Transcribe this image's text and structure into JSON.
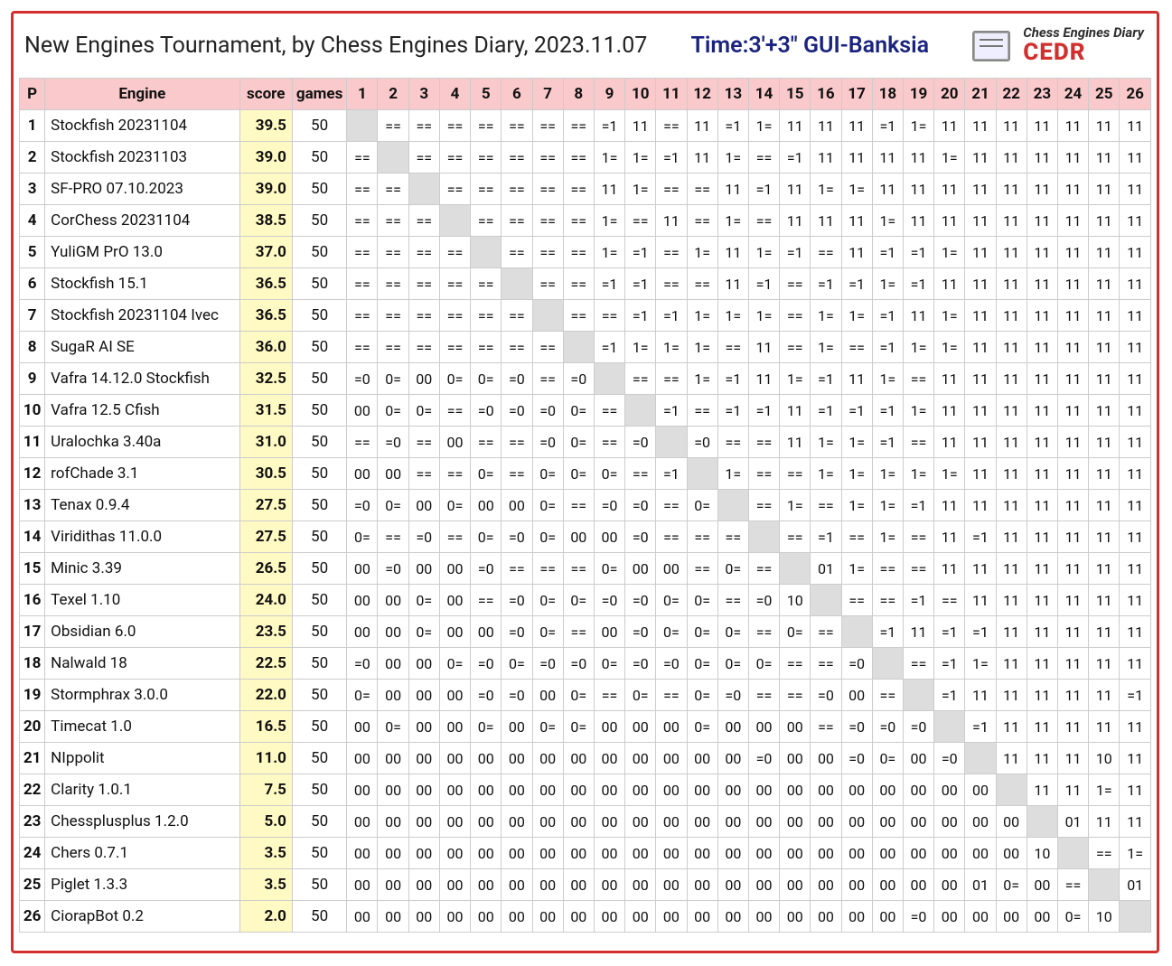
{
  "header": {
    "title": "New Engines Tournament, by Chess Engines Diary, 2023.11.07",
    "meta": "Time:3'+3\"  GUI-Banksia",
    "brand_line1": "Chess Engines Diary",
    "brand_line2": "CEDR"
  },
  "columns": {
    "p": "P",
    "engine": "Engine",
    "score": "score",
    "games": "games",
    "rounds": [
      "1",
      "2",
      "3",
      "4",
      "5",
      "6",
      "7",
      "8",
      "9",
      "10",
      "11",
      "12",
      "13",
      "14",
      "15",
      "16",
      "17",
      "18",
      "19",
      "20",
      "21",
      "22",
      "23",
      "24",
      "25",
      "26"
    ]
  },
  "rows": [
    {
      "p": "1",
      "engine": "Stockfish 20231104",
      "score": "39.5",
      "games": "50",
      "r": [
        "",
        "==",
        "==",
        "==",
        "==",
        "==",
        "==",
        "==",
        "=1",
        "11",
        "==",
        "11",
        "=1",
        "1=",
        "11",
        "11",
        "11",
        "=1",
        "1=",
        "11",
        "11",
        "11",
        "11",
        "11",
        "11",
        "11"
      ]
    },
    {
      "p": "2",
      "engine": "Stockfish 20231103",
      "score": "39.0",
      "games": "50",
      "r": [
        "==",
        "",
        "==",
        "==",
        "==",
        "==",
        "==",
        "==",
        "1=",
        "1=",
        "=1",
        "11",
        "1=",
        "==",
        "=1",
        "11",
        "11",
        "11",
        "11",
        "1=",
        "11",
        "11",
        "11",
        "11",
        "11",
        "11"
      ]
    },
    {
      "p": "3",
      "engine": "SF-PRO 07.10.2023",
      "score": "39.0",
      "games": "50",
      "r": [
        "==",
        "==",
        "",
        "==",
        "==",
        "==",
        "==",
        "==",
        "11",
        "1=",
        "==",
        "==",
        "11",
        "=1",
        "11",
        "1=",
        "1=",
        "11",
        "11",
        "11",
        "11",
        "11",
        "11",
        "11",
        "11",
        "11"
      ]
    },
    {
      "p": "4",
      "engine": "CorChess 20231104",
      "score": "38.5",
      "games": "50",
      "r": [
        "==",
        "==",
        "==",
        "",
        "==",
        "==",
        "==",
        "==",
        "1=",
        "==",
        "11",
        "==",
        "1=",
        "==",
        "11",
        "11",
        "11",
        "1=",
        "11",
        "11",
        "11",
        "11",
        "11",
        "11",
        "11",
        "11"
      ]
    },
    {
      "p": "5",
      "engine": "YuliGM PrO 13.0",
      "score": "37.0",
      "games": "50",
      "r": [
        "==",
        "==",
        "==",
        "==",
        "",
        "==",
        "==",
        "==",
        "1=",
        "=1",
        "==",
        "1=",
        "11",
        "1=",
        "=1",
        "==",
        "11",
        "=1",
        "=1",
        "1=",
        "11",
        "11",
        "11",
        "11",
        "11",
        "11"
      ]
    },
    {
      "p": "6",
      "engine": "Stockfish 15.1",
      "score": "36.5",
      "games": "50",
      "r": [
        "==",
        "==",
        "==",
        "==",
        "==",
        "",
        "==",
        "==",
        "=1",
        "=1",
        "==",
        "==",
        "11",
        "=1",
        "==",
        "=1",
        "=1",
        "1=",
        "=1",
        "11",
        "11",
        "11",
        "11",
        "11",
        "11",
        "11"
      ]
    },
    {
      "p": "7",
      "engine": "Stockfish 20231104 Ivec",
      "score": "36.5",
      "games": "50",
      "r": [
        "==",
        "==",
        "==",
        "==",
        "==",
        "==",
        "",
        "==",
        "==",
        "=1",
        "=1",
        "1=",
        "1=",
        "1=",
        "==",
        "1=",
        "1=",
        "=1",
        "11",
        "1=",
        "11",
        "11",
        "11",
        "11",
        "11",
        "11"
      ]
    },
    {
      "p": "8",
      "engine": "SugaR AI SE",
      "score": "36.0",
      "games": "50",
      "r": [
        "==",
        "==",
        "==",
        "==",
        "==",
        "==",
        "==",
        "",
        "=1",
        "1=",
        "1=",
        "1=",
        "==",
        "11",
        "==",
        "1=",
        "==",
        "=1",
        "1=",
        "1=",
        "11",
        "11",
        "11",
        "11",
        "11",
        "11"
      ]
    },
    {
      "p": "9",
      "engine": "Vafra 14.12.0 Stockfish",
      "score": "32.5",
      "games": "50",
      "r": [
        "=0",
        "0=",
        "00",
        "0=",
        "0=",
        "=0",
        "==",
        "=0",
        "",
        "==",
        "==",
        "1=",
        "=1",
        "11",
        "1=",
        "=1",
        "11",
        "1=",
        "==",
        "11",
        "11",
        "11",
        "11",
        "11",
        "11",
        "11"
      ]
    },
    {
      "p": "10",
      "engine": "Vafra 12.5 Cfish",
      "score": "31.5",
      "games": "50",
      "r": [
        "00",
        "0=",
        "0=",
        "==",
        "=0",
        "=0",
        "=0",
        "0=",
        "==",
        "",
        "=1",
        "==",
        "=1",
        "=1",
        "11",
        "=1",
        "=1",
        "=1",
        "1=",
        "11",
        "11",
        "11",
        "11",
        "11",
        "11",
        "11"
      ]
    },
    {
      "p": "11",
      "engine": "Uralochka 3.40a",
      "score": "31.0",
      "games": "50",
      "r": [
        "==",
        "=0",
        "==",
        "00",
        "==",
        "==",
        "=0",
        "0=",
        "==",
        "=0",
        "",
        "=0",
        "==",
        "==",
        "11",
        "1=",
        "1=",
        "=1",
        "==",
        "11",
        "11",
        "11",
        "11",
        "11",
        "11",
        "11"
      ]
    },
    {
      "p": "12",
      "engine": "rofChade 3.1",
      "score": "30.5",
      "games": "50",
      "r": [
        "00",
        "00",
        "==",
        "==",
        "0=",
        "==",
        "0=",
        "0=",
        "0=",
        "==",
        "=1",
        "",
        "1=",
        "==",
        "==",
        "1=",
        "1=",
        "1=",
        "1=",
        "1=",
        "11",
        "11",
        "11",
        "11",
        "11",
        "11"
      ]
    },
    {
      "p": "13",
      "engine": "Tenax 0.9.4",
      "score": "27.5",
      "games": "50",
      "r": [
        "=0",
        "0=",
        "00",
        "0=",
        "00",
        "00",
        "0=",
        "==",
        "=0",
        "=0",
        "==",
        "0=",
        "",
        "==",
        "1=",
        "==",
        "1=",
        "1=",
        "=1",
        "11",
        "11",
        "11",
        "11",
        "11",
        "11",
        "11"
      ]
    },
    {
      "p": "14",
      "engine": "Viridithas 11.0.0",
      "score": "27.5",
      "games": "50",
      "r": [
        "0=",
        "==",
        "=0",
        "==",
        "0=",
        "=0",
        "0=",
        "00",
        "00",
        "=0",
        "==",
        "==",
        "==",
        "",
        "==",
        "=1",
        "==",
        "1=",
        "==",
        "11",
        "=1",
        "11",
        "11",
        "11",
        "11",
        "11"
      ]
    },
    {
      "p": "15",
      "engine": "Minic 3.39",
      "score": "26.5",
      "games": "50",
      "r": [
        "00",
        "=0",
        "00",
        "00",
        "=0",
        "==",
        "==",
        "==",
        "0=",
        "00",
        "00",
        "==",
        "0=",
        "==",
        "",
        "01",
        "1=",
        "==",
        "==",
        "11",
        "11",
        "11",
        "11",
        "11",
        "11",
        "11"
      ]
    },
    {
      "p": "16",
      "engine": "Texel 1.10",
      "score": "24.0",
      "games": "50",
      "r": [
        "00",
        "00",
        "0=",
        "00",
        "==",
        "=0",
        "0=",
        "0=",
        "=0",
        "=0",
        "0=",
        "0=",
        "==",
        "=0",
        "10",
        "",
        "==",
        "==",
        "=1",
        "==",
        "11",
        "11",
        "11",
        "11",
        "11",
        "11"
      ]
    },
    {
      "p": "17",
      "engine": "Obsidian 6.0",
      "score": "23.5",
      "games": "50",
      "r": [
        "00",
        "00",
        "0=",
        "00",
        "00",
        "=0",
        "0=",
        "==",
        "00",
        "=0",
        "0=",
        "0=",
        "0=",
        "==",
        "0=",
        "==",
        "",
        "=1",
        "11",
        "=1",
        "=1",
        "11",
        "11",
        "11",
        "11",
        "11"
      ]
    },
    {
      "p": "18",
      "engine": "Nalwald 18",
      "score": "22.5",
      "games": "50",
      "r": [
        "=0",
        "00",
        "00",
        "0=",
        "=0",
        "0=",
        "=0",
        "=0",
        "0=",
        "=0",
        "=0",
        "0=",
        "0=",
        "0=",
        "==",
        "==",
        "=0",
        "",
        "==",
        "=1",
        "1=",
        "11",
        "11",
        "11",
        "11",
        "11"
      ]
    },
    {
      "p": "19",
      "engine": "Stormphrax 3.0.0",
      "score": "22.0",
      "games": "50",
      "r": [
        "0=",
        "00",
        "00",
        "00",
        "=0",
        "=0",
        "00",
        "0=",
        "==",
        "0=",
        "==",
        "0=",
        "=0",
        "==",
        "==",
        "=0",
        "00",
        "==",
        "",
        "=1",
        "11",
        "11",
        "11",
        "11",
        "11",
        "=1"
      ]
    },
    {
      "p": "20",
      "engine": "Timecat 1.0",
      "score": "16.5",
      "games": "50",
      "r": [
        "00",
        "0=",
        "00",
        "00",
        "0=",
        "00",
        "0=",
        "0=",
        "00",
        "00",
        "00",
        "0=",
        "00",
        "00",
        "00",
        "==",
        "=0",
        "=0",
        "=0",
        "",
        "=1",
        "11",
        "11",
        "11",
        "11",
        "11"
      ]
    },
    {
      "p": "21",
      "engine": "NIppolit",
      "score": "11.0",
      "games": "50",
      "r": [
        "00",
        "00",
        "00",
        "00",
        "00",
        "00",
        "00",
        "00",
        "00",
        "00",
        "00",
        "00",
        "00",
        "=0",
        "00",
        "00",
        "=0",
        "0=",
        "00",
        "=0",
        "",
        "11",
        "11",
        "11",
        "10",
        "11"
      ]
    },
    {
      "p": "22",
      "engine": "Clarity 1.0.1",
      "score": "7.5",
      "games": "50",
      "r": [
        "00",
        "00",
        "00",
        "00",
        "00",
        "00",
        "00",
        "00",
        "00",
        "00",
        "00",
        "00",
        "00",
        "00",
        "00",
        "00",
        "00",
        "00",
        "00",
        "00",
        "00",
        "",
        "11",
        "11",
        "1=",
        "11"
      ]
    },
    {
      "p": "23",
      "engine": "Chessplusplus 1.2.0",
      "score": "5.0",
      "games": "50",
      "r": [
        "00",
        "00",
        "00",
        "00",
        "00",
        "00",
        "00",
        "00",
        "00",
        "00",
        "00",
        "00",
        "00",
        "00",
        "00",
        "00",
        "00",
        "00",
        "00",
        "00",
        "00",
        "00",
        "",
        "01",
        "11",
        "11"
      ]
    },
    {
      "p": "24",
      "engine": "Chers 0.7.1",
      "score": "3.5",
      "games": "50",
      "r": [
        "00",
        "00",
        "00",
        "00",
        "00",
        "00",
        "00",
        "00",
        "00",
        "00",
        "00",
        "00",
        "00",
        "00",
        "00",
        "00",
        "00",
        "00",
        "00",
        "00",
        "00",
        "00",
        "10",
        "",
        "==",
        "1="
      ]
    },
    {
      "p": "25",
      "engine": "Piglet 1.3.3",
      "score": "3.5",
      "games": "50",
      "r": [
        "00",
        "00",
        "00",
        "00",
        "00",
        "00",
        "00",
        "00",
        "00",
        "00",
        "00",
        "00",
        "00",
        "00",
        "00",
        "00",
        "00",
        "00",
        "00",
        "00",
        "01",
        "0=",
        "00",
        "==",
        "",
        "01"
      ]
    },
    {
      "p": "26",
      "engine": "CiorapBot 0.2",
      "score": "2.0",
      "games": "50",
      "r": [
        "00",
        "00",
        "00",
        "00",
        "00",
        "00",
        "00",
        "00",
        "00",
        "00",
        "00",
        "00",
        "00",
        "00",
        "00",
        "00",
        "00",
        "00",
        "=0",
        "00",
        "00",
        "00",
        "00",
        "0=",
        "10",
        ""
      ]
    }
  ]
}
